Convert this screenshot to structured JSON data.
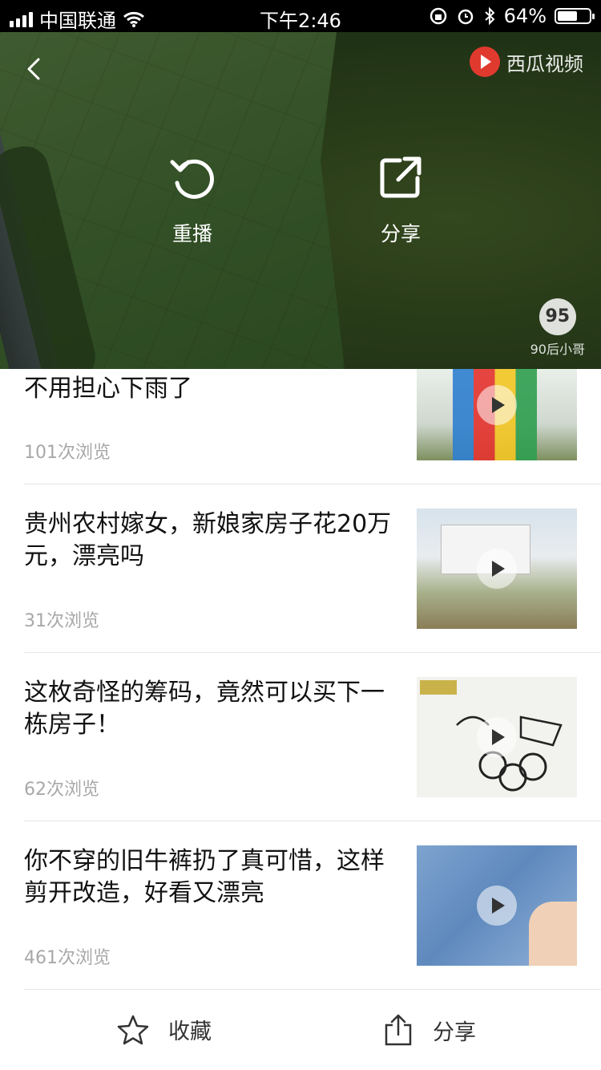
{
  "status_bar": {
    "carrier": "中国联通",
    "time": "下午2:46",
    "battery": "64%",
    "battery_level": 0.64
  },
  "player": {
    "logo_text": "西瓜视频",
    "replay_label": "重播",
    "share_label": "分享",
    "watermark_badge": "95",
    "watermark_text": "90后小哥"
  },
  "feed": [
    {
      "title": "不用担心下雨了",
      "views": "101次浏览"
    },
    {
      "title": "贵州农村嫁女，新娘家房子花20万元，漂亮吗",
      "views": "31次浏览"
    },
    {
      "title": "这枚奇怪的筹码，竟然可以买下一栋房子！",
      "views": "62次浏览"
    },
    {
      "title": "你不穿的旧牛裤扔了真可惜，这样剪开改造，好看又漂亮",
      "views": "461次浏览"
    }
  ],
  "bottom_bar": {
    "favorite_label": "收藏",
    "share_label": "分享"
  }
}
